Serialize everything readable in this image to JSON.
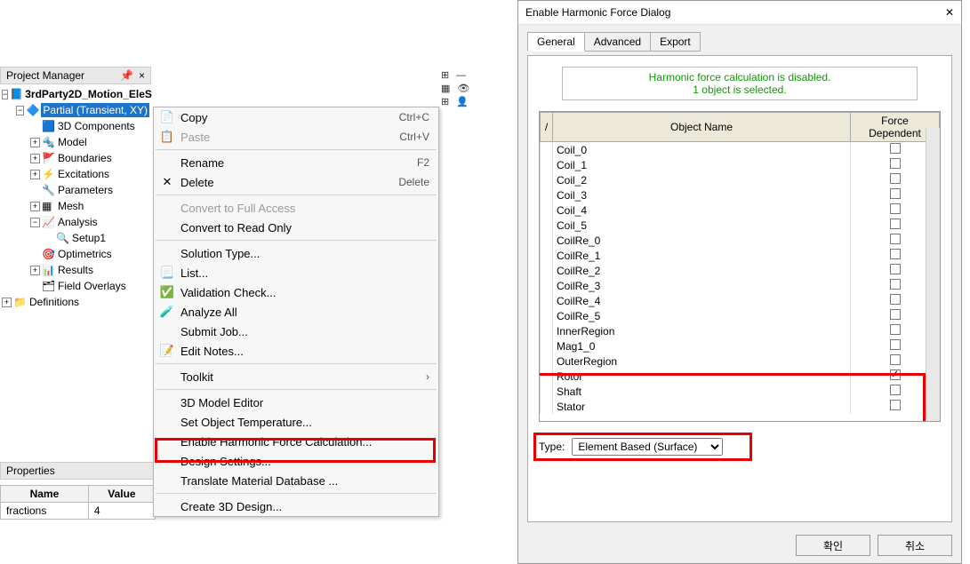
{
  "project_manager": {
    "title": "Project Manager",
    "nodes": {
      "root": "3rdParty2D_Motion_EleS",
      "partial": "Partial (Transient, XY)",
      "threeD": "3D Components",
      "model": "Model",
      "boundaries": "Boundaries",
      "excitations": "Excitations",
      "parameters": "Parameters",
      "mesh": "Mesh",
      "analysis": "Analysis",
      "setup1": "Setup1",
      "optimetrics": "Optimetrics",
      "results": "Results",
      "fieldoverlays": "Field Overlays",
      "definitions": "Definitions"
    },
    "pin": "📌",
    "close": "×"
  },
  "properties": {
    "title": "Properties",
    "headers": {
      "name": "Name",
      "value": "Value"
    },
    "rows": [
      {
        "name": "fractions",
        "value": "4"
      }
    ]
  },
  "context_menu": {
    "copy": "Copy",
    "copy_kb": "Ctrl+C",
    "copy_icon": "📄",
    "paste": "Paste",
    "paste_kb": "Ctrl+V",
    "rename": "Rename",
    "rename_kb": "F2",
    "delete": "Delete",
    "delete_kb": "Delete",
    "delete_icon": "✕",
    "convert_full": "Convert to Full Access",
    "convert_read": "Convert to Read Only",
    "solution_type": "Solution Type...",
    "list": "List...",
    "validation": "Validation Check...",
    "analyze_all": "Analyze All",
    "submit_job": "Submit Job...",
    "edit_notes": "Edit Notes...",
    "toolkit": "Toolkit",
    "model_editor": "3D Model Editor",
    "set_obj_temp": "Set Object Temperature...",
    "enable_harmonic": "Enable Harmonic Force Calculation...",
    "design_settings": "Design Settings...",
    "translate_db": "Translate Material Database ...",
    "create_3d": "Create 3D Design..."
  },
  "dialog": {
    "title": "Enable Harmonic Force Dialog",
    "close_x": "✕",
    "tabs": {
      "general": "General",
      "advanced": "Advanced",
      "export": "Export"
    },
    "status1": "Harmonic force calculation is disabled.",
    "status2": "1 object is selected.",
    "col_slash": "/",
    "col_name": "Object Name",
    "col_fd": "Force Dependent",
    "objects": [
      {
        "name": "Coil_0",
        "checked": false
      },
      {
        "name": "Coil_1",
        "checked": false
      },
      {
        "name": "Coil_2",
        "checked": false
      },
      {
        "name": "Coil_3",
        "checked": false
      },
      {
        "name": "Coil_4",
        "checked": false
      },
      {
        "name": "Coil_5",
        "checked": false
      },
      {
        "name": "CoilRe_0",
        "checked": false
      },
      {
        "name": "CoilRe_1",
        "checked": false
      },
      {
        "name": "CoilRe_2",
        "checked": false
      },
      {
        "name": "CoilRe_3",
        "checked": false
      },
      {
        "name": "CoilRe_4",
        "checked": false
      },
      {
        "name": "CoilRe_5",
        "checked": false
      },
      {
        "name": "InnerRegion",
        "checked": false
      },
      {
        "name": "Mag1_0",
        "checked": false
      },
      {
        "name": "OuterRegion",
        "checked": false
      },
      {
        "name": "Rotor",
        "checked": true
      },
      {
        "name": "Shaft",
        "checked": false
      },
      {
        "name": "Stator",
        "checked": false
      }
    ],
    "type_label": "Type:",
    "type_value": "Element Based (Surface)",
    "ok": "확인",
    "cancel": "취소"
  },
  "back_toolbar": {
    "icons": [
      "⊞ —",
      "▦ 👓",
      "⊞ 👤"
    ]
  }
}
